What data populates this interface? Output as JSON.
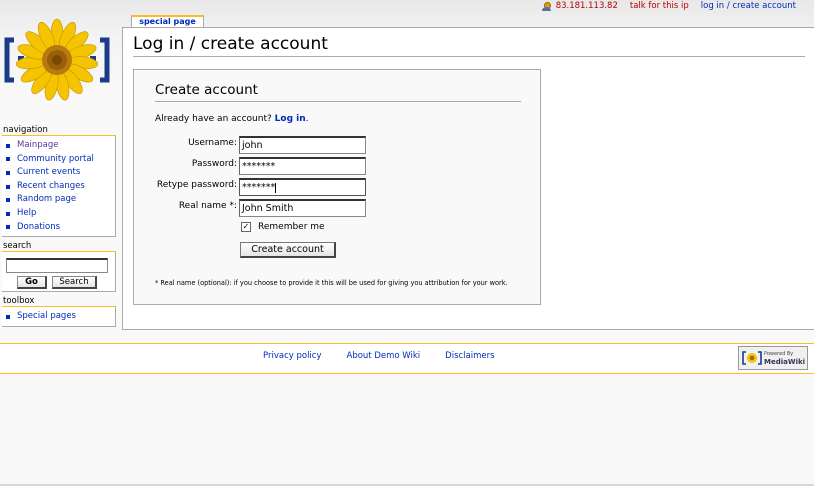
{
  "personal": {
    "user": "83.181.113.82",
    "talk": "talk for this ip",
    "login": "log in / create account"
  },
  "tab": {
    "label": "special page"
  },
  "page": {
    "title": "Log in / create account"
  },
  "form": {
    "heading": "Create account",
    "already_text": "Already have an account?",
    "login_link": "Log in",
    "period": ".",
    "fields": [
      {
        "label": "Username:",
        "value": "john"
      },
      {
        "label": "Password:",
        "value": "*******"
      },
      {
        "label": "Retype password:",
        "value": "*******"
      },
      {
        "label": "Real name *:",
        "value": "John Smith"
      }
    ],
    "remember_label": "Remember me",
    "remember_checked": "✓",
    "create_button": "Create account",
    "footnote": "* Real name (optional): if you choose to provide it this will be used for giving you attribution for your work."
  },
  "sidebar": {
    "navigation_title": "navigation",
    "navigation": [
      "Mainpage",
      "Community portal",
      "Current events",
      "Recent changes",
      "Random page",
      "Help",
      "Donations"
    ],
    "search_title": "search",
    "go_button": "Go",
    "search_button": "Search",
    "toolbox_title": "toolbox",
    "toolbox": [
      "Special pages"
    ]
  },
  "footer": {
    "links": [
      "Privacy policy",
      "About Demo Wiki",
      "Disclaimers"
    ],
    "powered_small": "Powered By",
    "powered_big": "MediaWiki"
  },
  "colors": {
    "link": "#002bb8",
    "visited": "#5a3696",
    "new": "#ba0000",
    "accent": "#fabd23"
  },
  "icons": {
    "logo": "sunflower-logo",
    "user": "user-icon",
    "powered": "mediawiki-logo"
  }
}
